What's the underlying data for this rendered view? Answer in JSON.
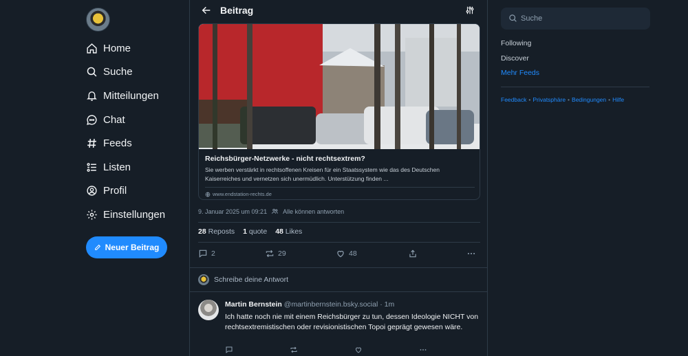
{
  "nav": {
    "items": [
      {
        "label": "Home",
        "icon": "home-icon"
      },
      {
        "label": "Suche",
        "icon": "search-icon"
      },
      {
        "label": "Mitteilungen",
        "icon": "bell-icon"
      },
      {
        "label": "Chat",
        "icon": "chat-bubble-icon"
      },
      {
        "label": "Feeds",
        "icon": "hash-icon"
      },
      {
        "label": "Listen",
        "icon": "list-icon"
      },
      {
        "label": "Profil",
        "icon": "user-circle-icon"
      },
      {
        "label": "Einstellungen",
        "icon": "gear-icon"
      }
    ],
    "compose_label": "Neuer Beitrag"
  },
  "header": {
    "title": "Beitrag"
  },
  "link_card": {
    "title": "Reichsbürger-Netzwerke - nicht rechtsextrem?",
    "description": "Sie werben verstärkt in rechtsoffenen Kreisen für ein Staatssystem wie das des Deutschen Kaiserreiches und vernetzen sich unermüdlich. Unterstützung finden ...",
    "domain": "www.endstation-rechts.de"
  },
  "post": {
    "date": "9. Januar 2025 um 09:21",
    "reply_setting": "Alle können antworten",
    "reposts_count": "28",
    "reposts_label": "Reposts",
    "quotes_count": "1",
    "quotes_label": "quote",
    "likes_count": "48",
    "likes_label": "Likes",
    "action_replies": "2",
    "action_reposts": "29",
    "action_likes": "48"
  },
  "reply_box": {
    "placeholder": "Schreibe deine Antwort"
  },
  "reply": {
    "author": "Martin Bernstein",
    "handle": "@martinbernstein.bsky.social",
    "time": "· 1m",
    "text": "Ich hatte noch nie mit einem Reichsbürger zu tun, dessen Ideologie NICHT von rechtsextremistischen oder revisionistischen Topoi geprägt gewesen wäre."
  },
  "right": {
    "search_placeholder": "Suche",
    "feeds": [
      "Following",
      "Discover"
    ],
    "more_feeds": "Mehr Feeds",
    "footer": [
      "Feedback",
      "Privatsphäre",
      "Bedingungen",
      "Hilfe"
    ]
  },
  "colors": {
    "bg": "#161e27",
    "accent": "#208bfe",
    "border": "#2e3b48",
    "muted": "#8fa0b0"
  }
}
